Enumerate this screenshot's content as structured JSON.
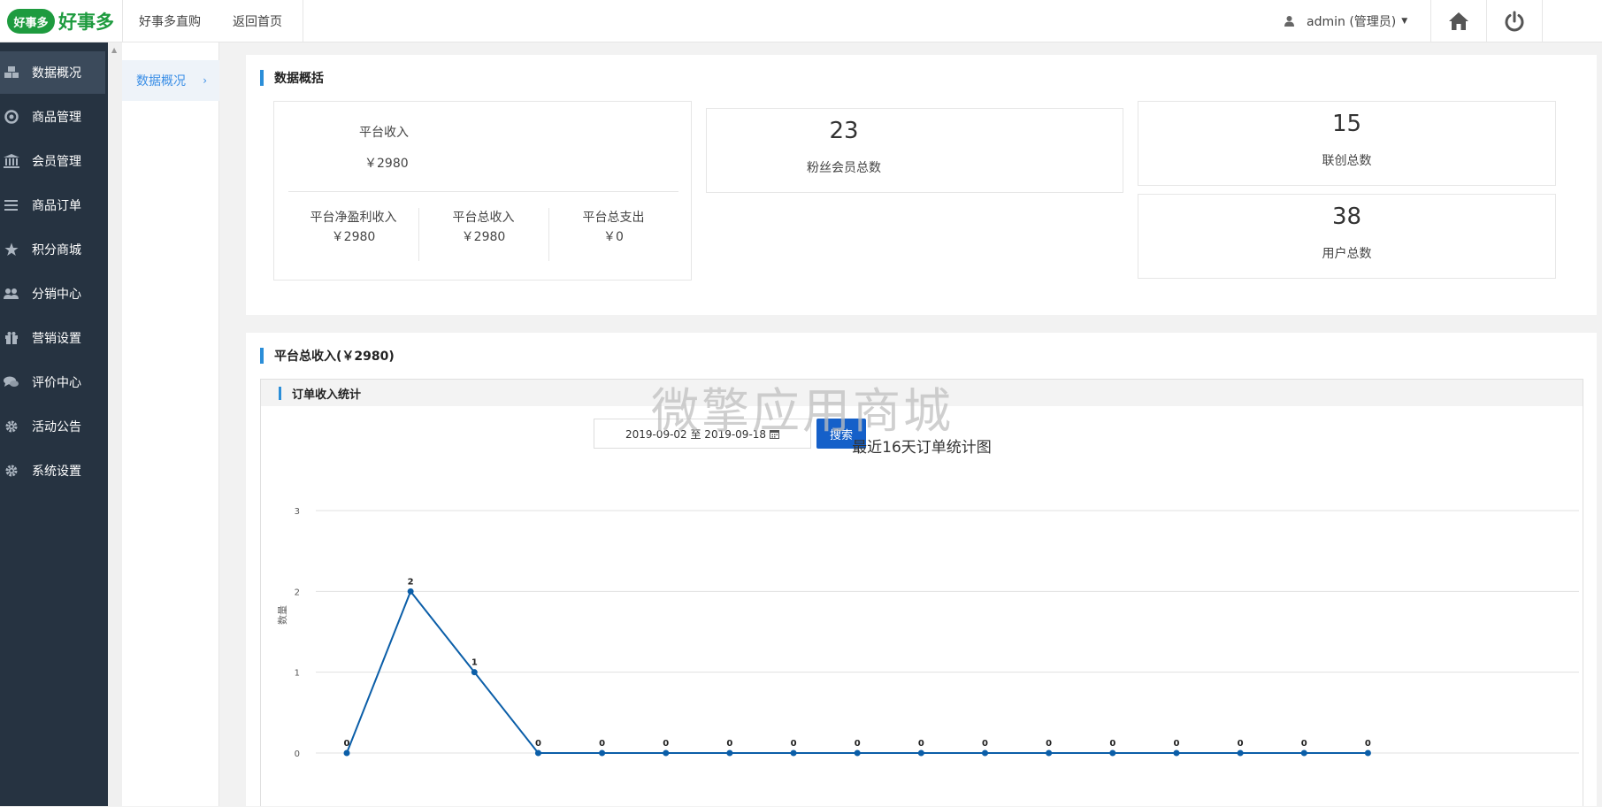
{
  "header": {
    "logo_badge": "好事多",
    "logo_text": "好事多",
    "nav": [
      "好事多直购",
      "返回首页"
    ],
    "user": "admin (管理员)",
    "home_icon": "home-icon",
    "power_icon": "power-icon"
  },
  "sidebar": {
    "items": [
      {
        "label": "数据概况",
        "icon": "cubes-icon",
        "active": true
      },
      {
        "label": "商品管理",
        "icon": "lifebuoy-icon"
      },
      {
        "label": "会员管理",
        "icon": "bank-icon"
      },
      {
        "label": "商品订单",
        "icon": "list-icon"
      },
      {
        "label": "积分商城",
        "icon": "star-icon"
      },
      {
        "label": "分销中心",
        "icon": "users-icon"
      },
      {
        "label": "营销设置",
        "icon": "gift-icon"
      },
      {
        "label": "评价中心",
        "icon": "comments-icon"
      },
      {
        "label": "活动公告",
        "icon": "gear-icon"
      },
      {
        "label": "系统设置",
        "icon": "gear-icon"
      }
    ]
  },
  "subnav": {
    "item": "数据概况",
    "arrow": "›"
  },
  "overview": {
    "title": "数据概括",
    "income_label": "平台收入",
    "income_value": "￥2980",
    "sub": [
      {
        "label": "平台净盈利收入",
        "value": "￥2980"
      },
      {
        "label": "平台总收入",
        "value": "￥2980"
      },
      {
        "label": "平台总支出",
        "value": "￥0"
      }
    ],
    "fans_value": "23",
    "fans_label": "粉丝会员总数",
    "lianchuang_value": "15",
    "lianchuang_label": "联创总数",
    "users_value": "38",
    "users_label": "用户总数"
  },
  "income_panel": {
    "title": "平台总收入(￥2980)",
    "chart_head": "订单收入统计",
    "date_range": "2019-09-02 至 2019-09-18",
    "search_label": "搜索",
    "watermark": "微擎应用商城"
  },
  "chart_data": {
    "type": "line",
    "title": "最近16天订单统计图",
    "ylabel": "数量",
    "xlabel": "",
    "ylim": [
      0,
      3
    ],
    "yticks": [
      0,
      1,
      2,
      3
    ],
    "grid": true,
    "color": "#0b5ea8",
    "values": [
      0,
      2,
      1,
      0,
      0,
      0,
      0,
      0,
      0,
      0,
      0,
      0,
      0,
      0,
      0,
      0,
      0
    ]
  }
}
